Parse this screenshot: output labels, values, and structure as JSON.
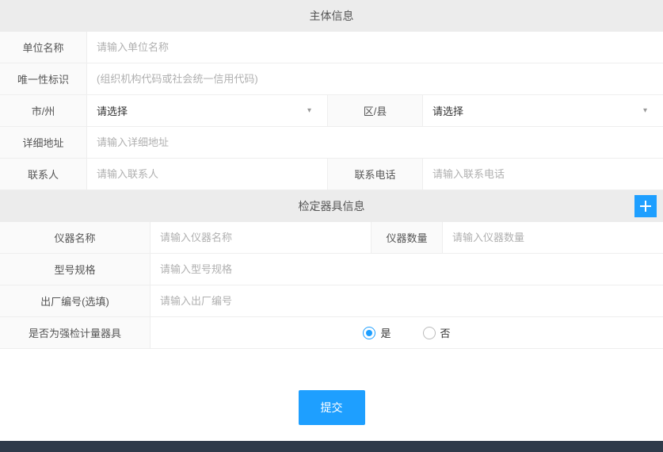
{
  "section1": {
    "title": "主体信息",
    "org_name": {
      "label": "单位名称",
      "placeholder": "请输入单位名称"
    },
    "unique_id": {
      "label": "唯一性标识",
      "placeholder": "(组织机构代码或社会统一信用代码)"
    },
    "city": {
      "label": "市/州",
      "selected": "请选择"
    },
    "district": {
      "label": "区/县",
      "selected": "请选择"
    },
    "address": {
      "label": "详细地址",
      "placeholder": "请输入详细地址"
    },
    "contact": {
      "label": "联系人",
      "placeholder": "请输入联系人"
    },
    "phone": {
      "label": "联系电话",
      "placeholder": "请输入联系电话"
    }
  },
  "section2": {
    "title": "检定器具信息",
    "instr_name": {
      "label": "仪器名称",
      "placeholder": "请输入仪器名称"
    },
    "instr_qty": {
      "label": "仪器数量",
      "placeholder": "请输入仪器数量"
    },
    "model": {
      "label": "型号规格",
      "placeholder": "请输入型号规格"
    },
    "serial": {
      "label": "出厂编号(选填)",
      "placeholder": "请输入出厂编号"
    },
    "mandatory": {
      "label": "是否为强检计量器具",
      "yes": "是",
      "no": "否"
    }
  },
  "submit_label": "提交"
}
